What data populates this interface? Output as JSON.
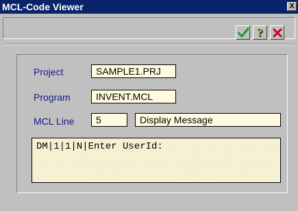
{
  "window": {
    "title": "MCL-Code Viewer",
    "close_label": "X"
  },
  "toolbar": {
    "ok_icon": "checkmark-icon",
    "help_icon": "question-icon",
    "cancel_icon": "x-icon",
    "help_label": "?"
  },
  "form": {
    "project_label": "Project",
    "project_value": "SAMPLE1.PRJ",
    "program_label": "Program",
    "program_value": "INVENT.MCL",
    "mcl_line_label": "MCL Line",
    "mcl_line_value": "5",
    "mcl_line_description": "Display Message",
    "code": "DM|1|1|N|Enter UserId:"
  },
  "colors": {
    "title_bar": "#0a246a",
    "label_text": "#1a1a8c",
    "field_bg": "#fffbe0",
    "check_green": "#1f9a1f",
    "cancel_red": "#c8001e"
  }
}
